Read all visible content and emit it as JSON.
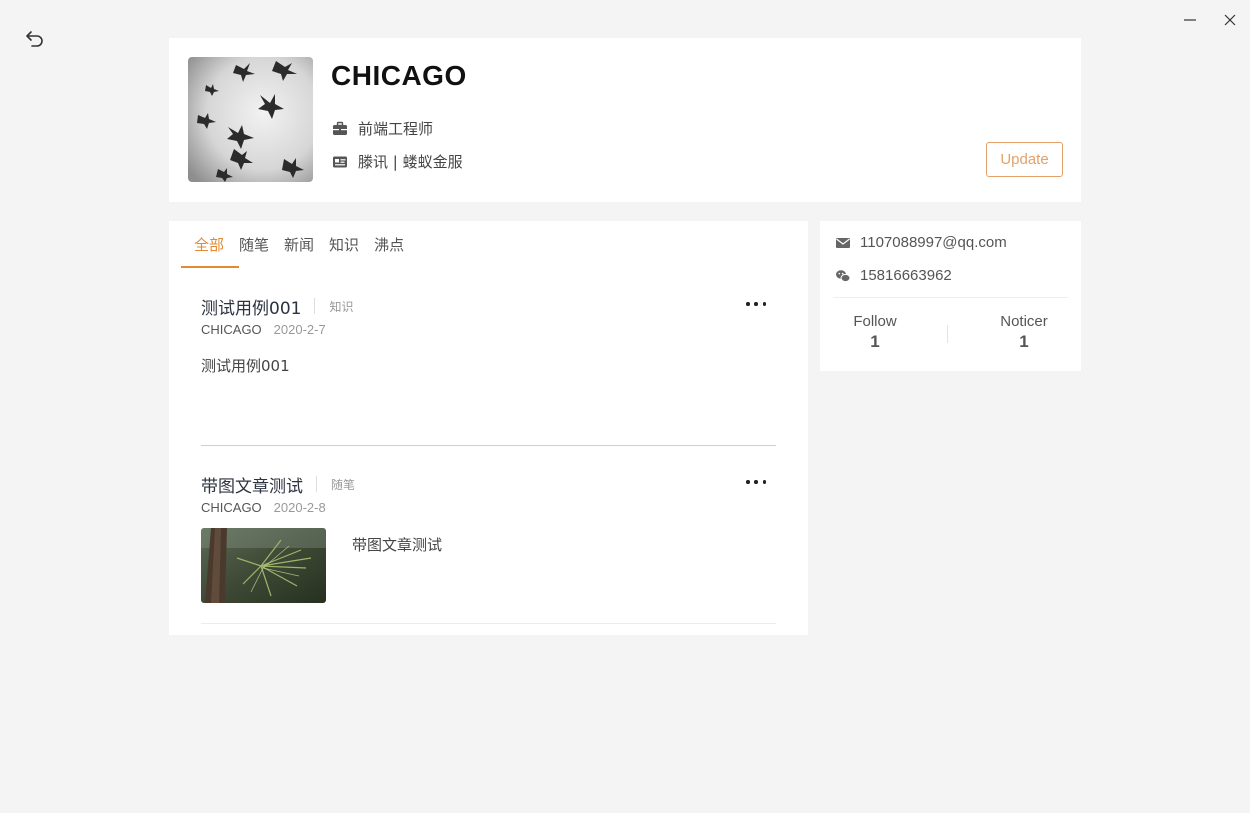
{
  "window": {
    "back_icon": "undo-arrow-icon",
    "minimize_icon": "minimize-icon",
    "close_icon": "close-icon"
  },
  "profile": {
    "name": "CHICAGO",
    "job_icon": "briefcase-icon",
    "job": "前端工程师",
    "company_icon": "id-card-icon",
    "company": "滕讯 | 蝼蚁金服",
    "update_label": "Update",
    "accent_color": "#e08a33"
  },
  "tabs": [
    {
      "label": "全部",
      "active": true
    },
    {
      "label": "随笔",
      "active": false
    },
    {
      "label": "新闻",
      "active": false
    },
    {
      "label": "知识",
      "active": false
    },
    {
      "label": "沸点",
      "active": false
    }
  ],
  "posts": [
    {
      "title": "测试用例001",
      "category": "知识",
      "author": "CHICAGO",
      "date": "2020-2-7",
      "body": "测试用例001"
    },
    {
      "title": "带图文章测试",
      "category": "随笔",
      "author": "CHICAGO",
      "date": "2020-2-8",
      "body": "带图文章测试"
    }
  ],
  "contact": {
    "email_icon": "envelope-icon",
    "email": "1107088997@qq.com",
    "phone_icon": "wechat-icon",
    "phone": "15816663962",
    "stats": [
      {
        "label": "Follow",
        "value": "1"
      },
      {
        "label": "Noticer",
        "value": "1"
      }
    ]
  }
}
